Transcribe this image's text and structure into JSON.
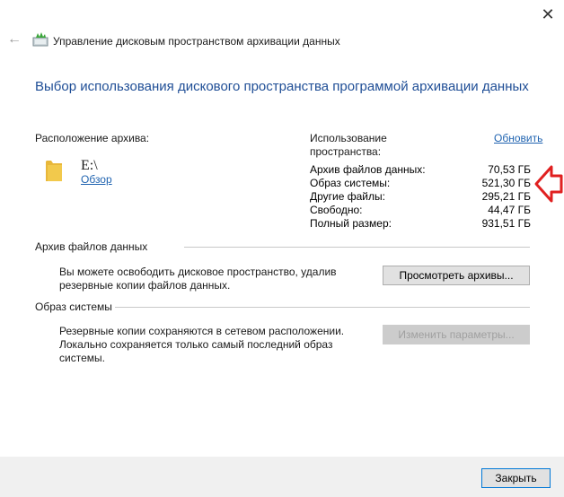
{
  "window": {
    "title": "Управление дисковым пространством архивации данных",
    "close_glyph": "✕",
    "back_glyph": "←"
  },
  "heading": "Выбор использования дискового пространства программой архивации данных",
  "location": {
    "label": "Расположение архива:",
    "drive": "E:\\",
    "browse_link": "Обзор"
  },
  "usage": {
    "title_line1": "Использование",
    "title_line2": "пространства:",
    "refresh_link": "Обновить",
    "rows": [
      {
        "label": "Архив файлов данных:",
        "value": "70,53 ГБ"
      },
      {
        "label": "Образ системы:",
        "value": "521,30 ГБ"
      },
      {
        "label": "Другие файлы:",
        "value": "295,21 ГБ"
      },
      {
        "label": "Свободно:",
        "value": "44,47 ГБ"
      },
      {
        "label": "Полный размер:",
        "value": "931,51 ГБ"
      }
    ]
  },
  "data_archive": {
    "heading": "Архив файлов данных",
    "description_line1": "Вы можете освободить дисковое пространство, удалив",
    "description_line2": "резервные копии файлов данных.",
    "button": "Просмотреть архивы..."
  },
  "system_image": {
    "heading": "Образ системы",
    "description_line1": "Резервные копии сохраняются в сетевом расположении.",
    "description_line2": "Локально сохраняется только самый последний образ",
    "description_line3": "системы.",
    "button": "Изменить параметры..."
  },
  "footer": {
    "close_button": "Закрыть"
  },
  "colors": {
    "heading": "#1f4e96",
    "link": "#1f63b0",
    "annotation_arrow": "#e02020",
    "folder": "#f2c94c"
  }
}
